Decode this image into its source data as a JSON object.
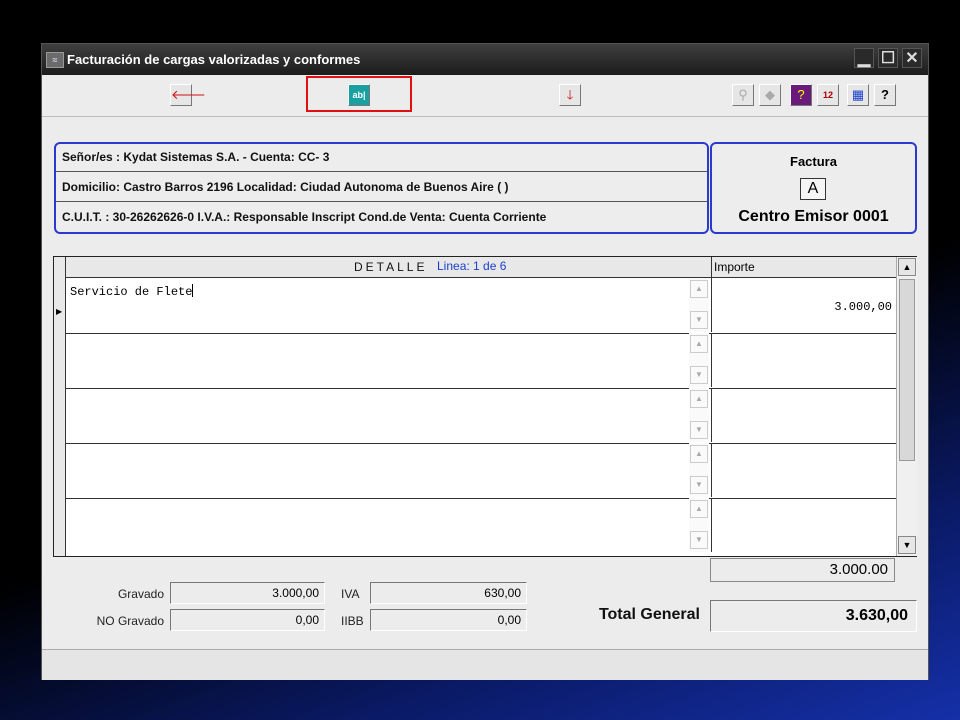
{
  "window": {
    "title": "Facturación de cargas valorizadas y conformes"
  },
  "toolbar": {
    "left_arrow_icon": "left-arrow-icon",
    "text_field_icon_label": "ab|",
    "down_arrow_icon": "down-arrow-icon",
    "help_label": "?",
    "calendar_label": "12",
    "info_label": "?"
  },
  "header": {
    "senor": "Señor/es : Kydat Sistemas S.A. - Cuenta: CC-      3",
    "domicilio": "Domicilio: Castro Barros 2196  Localidad: Ciudad Autonoma de Buenos Aire (        )",
    "cuit": "C.U.I.T. : 30-26262626-0      I.V.A.: Responsable Inscript Cond.de Venta: Cuenta Corriente"
  },
  "factura": {
    "label": "Factura",
    "letter": "A",
    "centro": "Centro Emisor 0001"
  },
  "grid": {
    "detalle_title": "DETALLE",
    "linea": "Linea: 1 de  6",
    "importe_header": "Importe",
    "rows": [
      {
        "desc": "Servicio de Flete",
        "amount": "3.000,00"
      },
      {
        "desc": "",
        "amount": ""
      },
      {
        "desc": "",
        "amount": ""
      },
      {
        "desc": "",
        "amount": ""
      },
      {
        "desc": "",
        "amount": ""
      }
    ],
    "subtotal": "3.000.00"
  },
  "totals": {
    "gravado_label": "Gravado",
    "gravado": "3.000,00",
    "no_gravado_label": "NO Gravado",
    "no_gravado": "0,00",
    "iva_label": "IVA",
    "iva": "630,00",
    "iibb_label": "IIBB",
    "iibb": "0,00",
    "total_general_label": "Total General",
    "total_general": "3.630,00"
  },
  "colors": {
    "accent_border": "#2a3acf",
    "highlight": "#e01010",
    "linea_text": "#1a3fd0"
  }
}
